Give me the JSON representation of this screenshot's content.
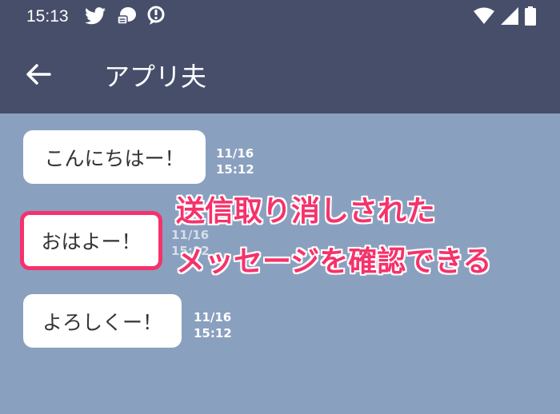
{
  "status_bar": {
    "time": "15:13",
    "left_icons": [
      "twitter-icon",
      "chat-notification-icon",
      "location-alert-icon"
    ],
    "right_icons": [
      "wifi-icon",
      "cellular-signal-icon",
      "battery-icon"
    ]
  },
  "app_bar": {
    "back_icon": "arrow-back-icon",
    "title": "アプリ夫"
  },
  "messages": [
    {
      "text": "こんにちはー！",
      "date": "11/16",
      "time": "15:12"
    },
    {
      "text": "おはよー！",
      "date": "11/16",
      "time": "15:12"
    },
    {
      "text": "よろしくー！",
      "date": "11/16",
      "time": "15:12"
    }
  ],
  "annotation": {
    "line1": "送信取り消しされた",
    "line2": "メッセージを確認できる"
  },
  "colors": {
    "status_bar_bg": "#474e6a",
    "chat_bg": "#8aa0bf",
    "highlight": "#f5326b",
    "bubble_bg": "#ffffff"
  }
}
